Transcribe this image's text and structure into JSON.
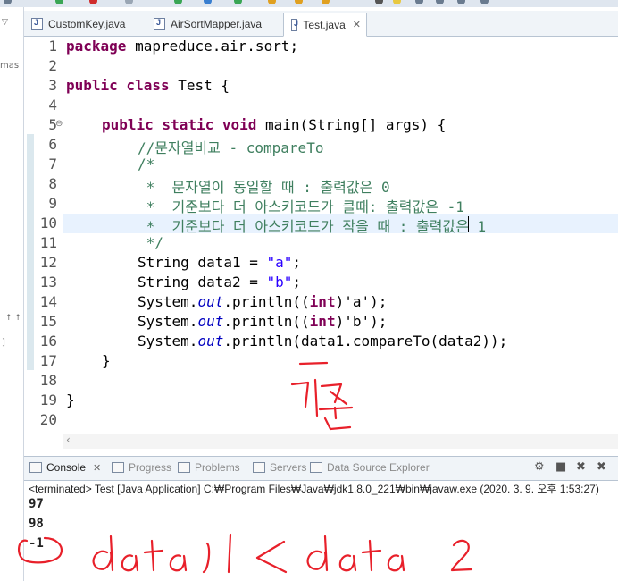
{
  "tabs": [
    {
      "label": "CustomKey.java"
    },
    {
      "label": "AirSortMapper.java"
    },
    {
      "label": "Test.java"
    }
  ],
  "sidebar": {
    "text1": "mas",
    "text2": "↑ ↑",
    "text3": "]"
  },
  "editor": {
    "lines": [
      {
        "num": "1"
      },
      {
        "num": "2"
      },
      {
        "num": "3"
      },
      {
        "num": "4"
      },
      {
        "num": "5"
      },
      {
        "num": "6"
      },
      {
        "num": "7"
      },
      {
        "num": "8"
      },
      {
        "num": "9"
      },
      {
        "num": "10"
      },
      {
        "num": "11"
      },
      {
        "num": "12"
      },
      {
        "num": "13"
      },
      {
        "num": "14"
      },
      {
        "num": "15"
      },
      {
        "num": "16"
      },
      {
        "num": "17"
      },
      {
        "num": "18"
      },
      {
        "num": "19"
      },
      {
        "num": "20"
      }
    ],
    "code": {
      "l1_kw": "package",
      "l1_rest": " mapreduce.air.sort;",
      "l3_kw": "public class",
      "l3_rest": " Test {",
      "l5_kw": "public static void",
      "l5_rest": " main(String[] args) {",
      "l6": "//문자열비교 - compareTo",
      "l7": "/*",
      "l8": " *  문자열이 동일할 때 : 출력값은 0",
      "l9": " *  기준보다 더 아스키코드가 클때: 출력값은 -1",
      "l10": " *  기준보다 더 아스키코드가 작을 때 : 출력값은 1",
      "l11": " */",
      "l12_a": "String data1 = ",
      "l12_s": "\"a\"",
      "l12_b": ";",
      "l13_a": "String data2 = ",
      "l13_s": "\"b\"",
      "l13_b": ";",
      "l14_a": "System.",
      "l14_f": "out",
      "l14_b": ".println((",
      "l14_k": "int",
      "l14_c": ")'a');",
      "l15_a": "System.",
      "l15_f": "out",
      "l15_b": ".println((",
      "l15_k": "int",
      "l15_c": ")'b');",
      "l16_a": "System.",
      "l16_f": "out",
      "l16_b": ".println(data1.compareTo(data2));",
      "l17": "}",
      "l19": "}"
    }
  },
  "console": {
    "tabs": [
      {
        "label": "Console"
      },
      {
        "label": "Progress"
      },
      {
        "label": "Problems"
      },
      {
        "label": "Servers"
      },
      {
        "label": "Data Source Explorer"
      }
    ],
    "terminated": "<terminated> Test [Java Application] C:₩Program Files₩Java₩jdk1.8.0_221₩bin₩javaw.exe (2020. 3. 9. 오후 1:53:27)",
    "output": [
      "97",
      "98",
      "-1"
    ]
  },
  "annotations": {
    "handwriting_1": "기준",
    "handwriting_2": "data1 < data2",
    "ink_color": "#e8202a"
  }
}
